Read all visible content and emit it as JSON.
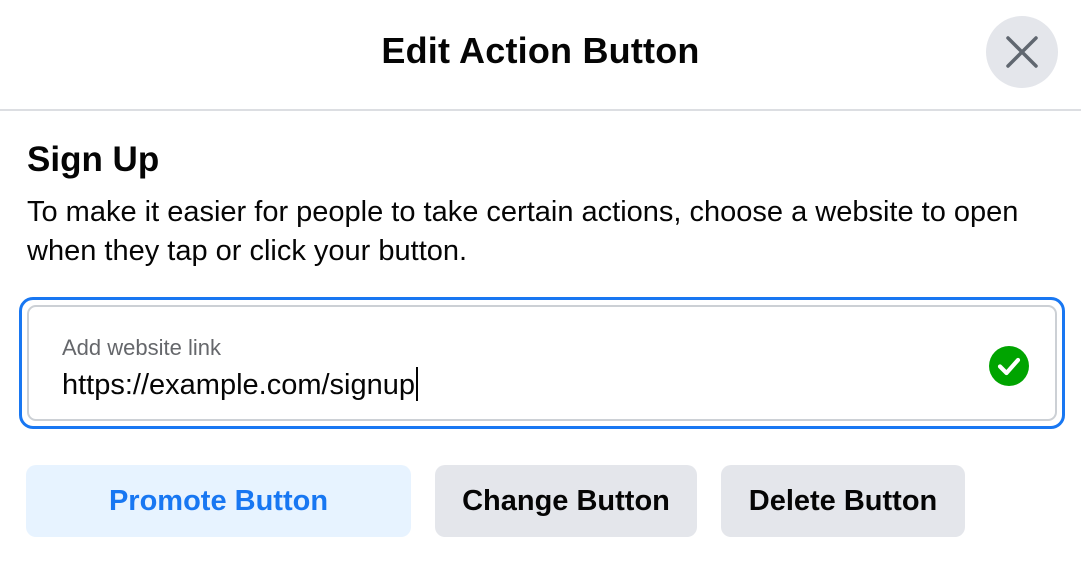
{
  "dialog": {
    "title": "Edit Action Button",
    "close_icon": "close-icon"
  },
  "section": {
    "title": "Sign Up",
    "description": "To make it easier for people to take certain actions, choose a website to open when they tap or click your button."
  },
  "website_field": {
    "label": "Add website link",
    "value": "https://example.com/signup",
    "status_icon": "check-circle-icon",
    "status_color": "#00a400"
  },
  "actions": {
    "promote_label": "Promote Button",
    "change_label": "Change Button",
    "delete_label": "Delete Button"
  },
  "colors": {
    "accent": "#1877f2",
    "accent_light": "#e7f3ff",
    "secondary_button": "#e4e6eb"
  }
}
